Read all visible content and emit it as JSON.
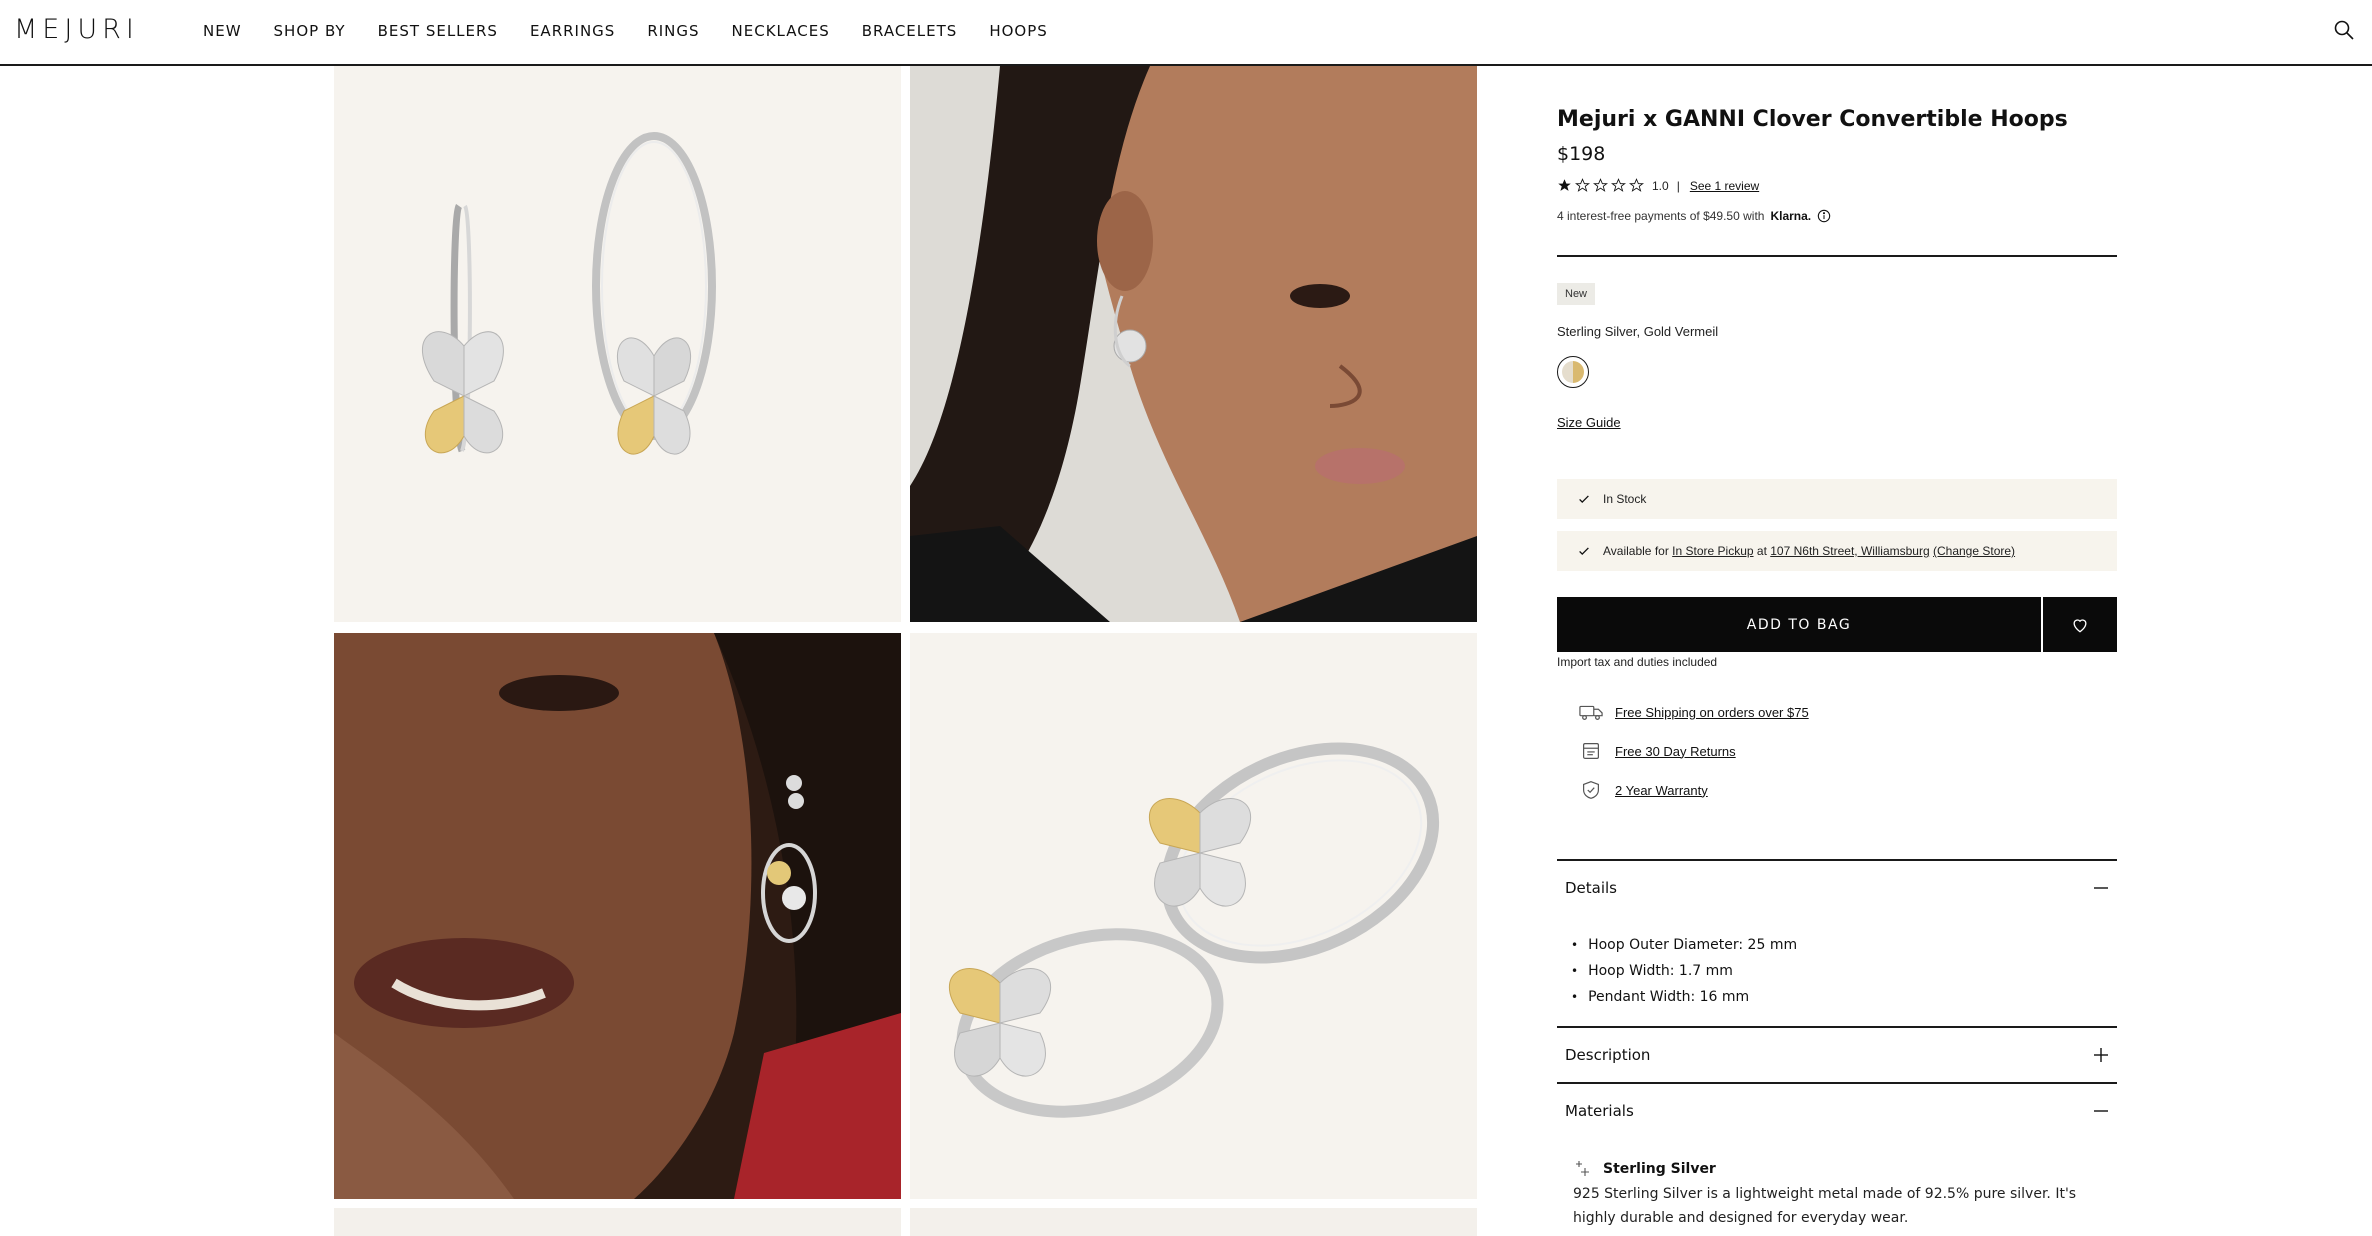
{
  "brand": {
    "logo": "MEJURI"
  },
  "nav": [
    {
      "label": "NEW"
    },
    {
      "label": "SHOP BY"
    },
    {
      "label": "BEST SELLERS"
    },
    {
      "label": "EARRINGS"
    },
    {
      "label": "RINGS"
    },
    {
      "label": "NECKLACES"
    },
    {
      "label": "BRACELETS"
    },
    {
      "label": "HOOPS"
    }
  ],
  "product": {
    "title": "Mejuri x GANNI Clover Convertible Hoops",
    "price": "$198",
    "rating": {
      "value": "1.0",
      "stars_filled": 1,
      "stars_total": 5,
      "separator": "|",
      "review_link": "See 1 review"
    },
    "klarna": {
      "prefix": "4 interest-free payments of $49.50 with",
      "brand": "Klarna."
    },
    "badge": "New",
    "variant_label": "Sterling Silver, Gold Vermeil",
    "size_guide": "Size Guide",
    "stock": {
      "status": "In Stock"
    },
    "pickup": {
      "prefix": "Available for",
      "pickup_link": "In Store Pickup",
      "at": "at",
      "store_link": "107 N6th Street, Williamsburg",
      "change_link": "(Change Store)"
    },
    "add_to_bag": "ADD TO BAG",
    "tax_note": "Import tax and duties included",
    "perks": [
      {
        "icon": "truck-icon",
        "label": "Free Shipping on orders over $75"
      },
      {
        "icon": "calendar-icon",
        "label": "Free 30 Day Returns"
      },
      {
        "icon": "shield-check-icon",
        "label": "2 Year Warranty"
      }
    ]
  },
  "accordion": {
    "details": {
      "label": "Details",
      "state": "open",
      "items": [
        "Hoop Outer Diameter: 25 mm",
        "Hoop Width: 1.7 mm",
        "Pendant Width: 16 mm"
      ]
    },
    "description": {
      "label": "Description",
      "state": "closed"
    },
    "materials": {
      "label": "Materials",
      "state": "open",
      "heading": "Sterling Silver",
      "text": "925 Sterling Silver is a lightweight metal made of 92.5% pure silver. It's highly durable and designed for everyday wear."
    }
  },
  "colors": {
    "accent": "#0a0a0a",
    "panel_bg": "#f7f4ed",
    "image_bg": "#f6f3ee",
    "gold": "#d9b970",
    "silver": "#d6d6d6"
  }
}
